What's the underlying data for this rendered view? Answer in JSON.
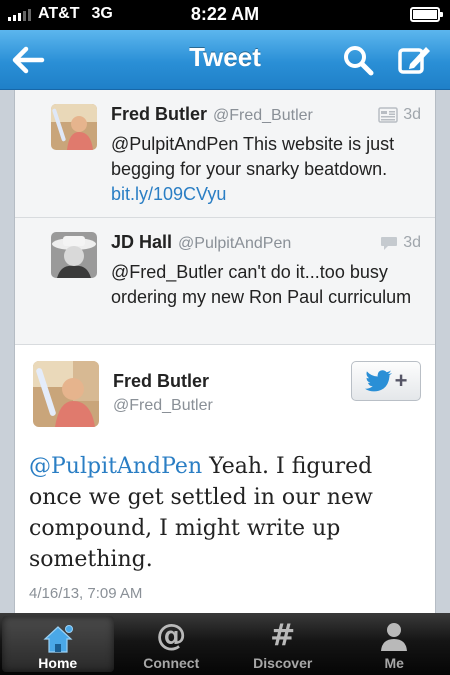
{
  "status_bar": {
    "carrier": "AT&T",
    "network": "3G",
    "time": "8:22 AM"
  },
  "nav_bar": {
    "title": "Tweet",
    "back_icon": "arrow-left-icon",
    "search_icon": "search-icon",
    "compose_icon": "compose-icon"
  },
  "replies": [
    {
      "name": "Fred Butler",
      "handle": "@Fred_Butler",
      "age": "3d",
      "text": "@PulpitAndPen This website is just begging for your snarky beatdown.",
      "link": "bit.ly/109CVyu",
      "meta_icon": "summary-card-icon"
    },
    {
      "name": "JD Hall",
      "handle": "@PulpitAndPen",
      "age": "3d",
      "text": "@Fred_Butler can't do it...too busy ordering my new Ron Paul curriculum",
      "meta_icon": "conversation-bubble-icon"
    }
  ],
  "main_tweet": {
    "name": "Fred Butler",
    "handle": "@Fred_Butler",
    "mention": "@PulpitAndPen",
    "text": " Yeah. I figured once we get settled in our new compound, I might write up something.",
    "timestamp": "4/16/13, 7:09 AM",
    "follow_icon": "follow-bird-plus-icon",
    "follow_plus": "+"
  },
  "tabs": [
    {
      "label": "Home",
      "icon": "home-icon",
      "active": true
    },
    {
      "label": "Connect",
      "icon": "at-sign-icon",
      "active": false,
      "glyph": "@"
    },
    {
      "label": "Discover",
      "icon": "hash-icon",
      "active": false,
      "glyph": "#"
    },
    {
      "label": "Me",
      "icon": "person-icon",
      "active": false
    }
  ],
  "colors": {
    "nav_blue": "#2a8fd6",
    "link_blue": "#2a7ec4",
    "tab_active_icon": "#4aa8e8"
  }
}
